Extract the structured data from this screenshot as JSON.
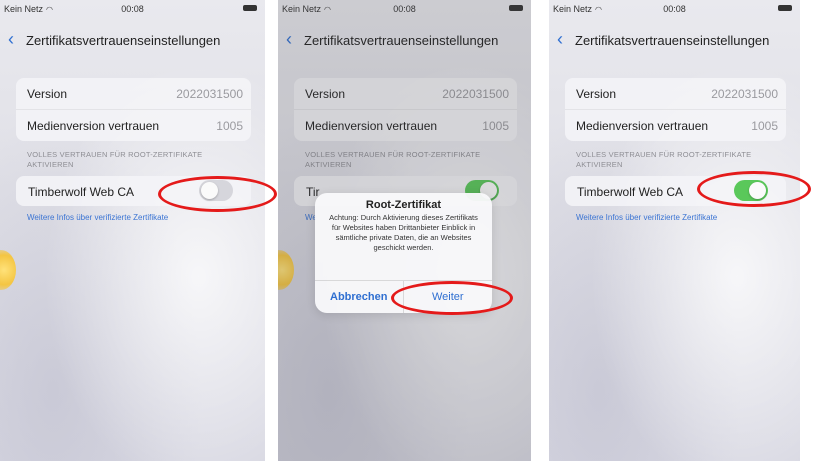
{
  "status": {
    "carrier": "Kein Netz",
    "time": "00:08"
  },
  "nav": {
    "back_icon": "chevron-left-icon",
    "title": "Zertifikatsvertrauenseinstellungen"
  },
  "info_rows": [
    {
      "label": "Version",
      "value": "2022031500"
    },
    {
      "label": "Medienversion vertrauen",
      "value": "1005"
    }
  ],
  "section": {
    "header": "VOLLES VERTRAUEN FÜR ROOT-ZERTIFIKATE AKTIVIEREN"
  },
  "certificate": {
    "label": "Timberwolf Web CA",
    "label_truncated": "Tir",
    "toggle_before": "off",
    "toggle_after": "on"
  },
  "link": {
    "text": "Weitere Infos über verifizierte Zertifikate",
    "text_truncated": "We"
  },
  "alert": {
    "title": "Root-Zertifikat",
    "message": "Achtung: Durch Aktivierung dieses Zertifikats für Websites haben Drittanbieter Einblick in sämtliche private Daten, die an Websites geschickt werden.",
    "cancel_label": "Abbrechen",
    "continue_label": "Weiter"
  },
  "colors": {
    "accent_blue": "#2f6fd1",
    "toggle_on": "#5ac85a",
    "annotation_red": "#e41a1a"
  }
}
